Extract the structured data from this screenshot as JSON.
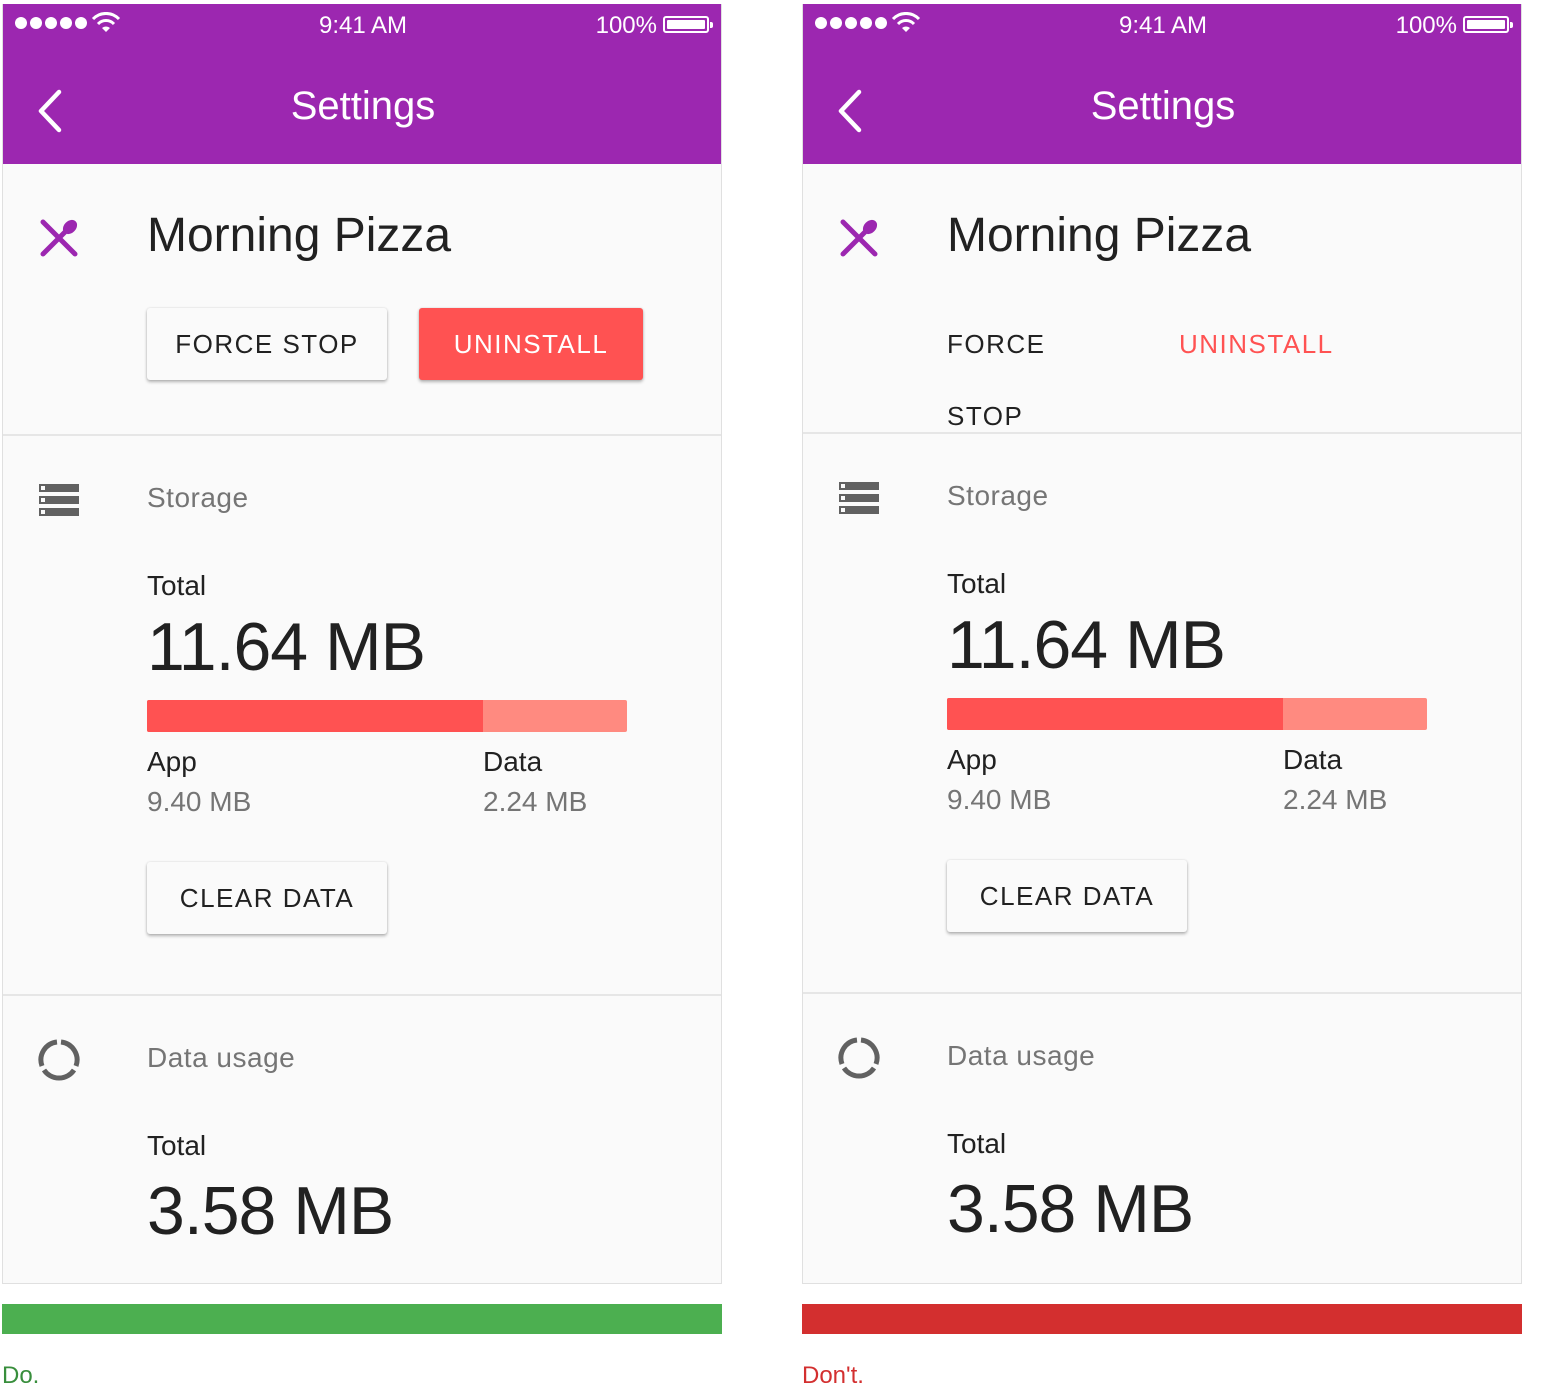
{
  "status_bar": {
    "time": "9:41 AM",
    "battery": "100%"
  },
  "header": {
    "title": "Settings"
  },
  "app": {
    "name": "Morning Pizza",
    "force_stop": "FORCE STOP",
    "uninstall": "UNINSTALL"
  },
  "storage": {
    "label": "Storage",
    "total_label": "Total",
    "total_value": "11.64 MB",
    "app_fraction": 0.7,
    "app_label": "App",
    "app_value": "9.40 MB",
    "data_label": "Data",
    "data_value": "2.24 MB",
    "clear_data": "CLEAR DATA"
  },
  "data_usage": {
    "label": "Data usage",
    "total_label": "Total",
    "total_value": "3.58 MB"
  },
  "examples": {
    "do_label": "Do.",
    "dont_label": "Don't."
  },
  "colors": {
    "app_bar": "#9c27b0",
    "accent": "#ff5252",
    "accent_light": "#ff8a80",
    "do": "#4caf50",
    "dont": "#d32f2f"
  },
  "icons": {
    "back": "chevron-left-icon",
    "app": "fork-spoon-icon",
    "storage": "storage-icon",
    "data_usage": "data-usage-icon"
  }
}
